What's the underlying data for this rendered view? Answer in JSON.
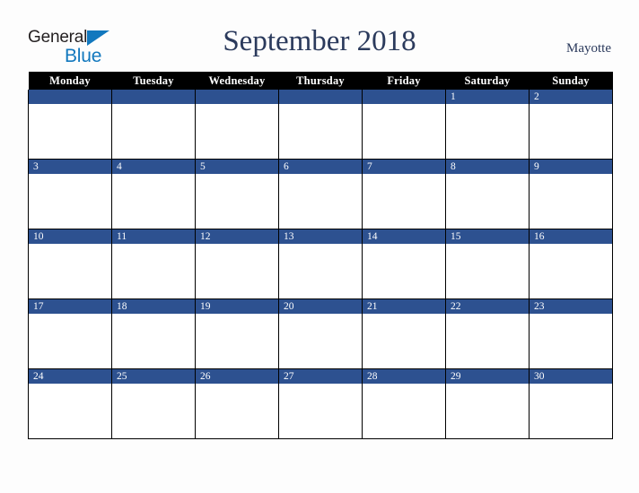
{
  "brand": {
    "name_part1": "General",
    "name_part2": "Blue",
    "triangle_icon": "triangle-icon",
    "color_primary": "#1278be",
    "color_text": "#231f20"
  },
  "header": {
    "title": "September 2018",
    "month": "September",
    "year": "2018",
    "location": "Mayotte",
    "title_color": "#2b3a5c"
  },
  "calendar": {
    "weekday_headers": [
      "Monday",
      "Tuesday",
      "Wednesday",
      "Thursday",
      "Friday",
      "Saturday",
      "Sunday"
    ],
    "header_background": "#000000",
    "header_text_color": "#ffffff",
    "daynum_background": "#2d5190",
    "daynum_text_color": "#ffffff",
    "cell_background": "#ffffff",
    "border_color": "#000000",
    "weeks": [
      {
        "days": [
          {
            "num": ""
          },
          {
            "num": ""
          },
          {
            "num": ""
          },
          {
            "num": ""
          },
          {
            "num": ""
          },
          {
            "num": "1"
          },
          {
            "num": "2"
          }
        ]
      },
      {
        "days": [
          {
            "num": "3"
          },
          {
            "num": "4"
          },
          {
            "num": "5"
          },
          {
            "num": "6"
          },
          {
            "num": "7"
          },
          {
            "num": "8"
          },
          {
            "num": "9"
          }
        ]
      },
      {
        "days": [
          {
            "num": "10"
          },
          {
            "num": "11"
          },
          {
            "num": "12"
          },
          {
            "num": "13"
          },
          {
            "num": "14"
          },
          {
            "num": "15"
          },
          {
            "num": "16"
          }
        ]
      },
      {
        "days": [
          {
            "num": "17"
          },
          {
            "num": "18"
          },
          {
            "num": "19"
          },
          {
            "num": "20"
          },
          {
            "num": "21"
          },
          {
            "num": "22"
          },
          {
            "num": "23"
          }
        ]
      },
      {
        "days": [
          {
            "num": "24"
          },
          {
            "num": "25"
          },
          {
            "num": "26"
          },
          {
            "num": "27"
          },
          {
            "num": "28"
          },
          {
            "num": "29"
          },
          {
            "num": "30"
          }
        ]
      }
    ]
  },
  "page": {
    "background": "#fdfdfd"
  }
}
